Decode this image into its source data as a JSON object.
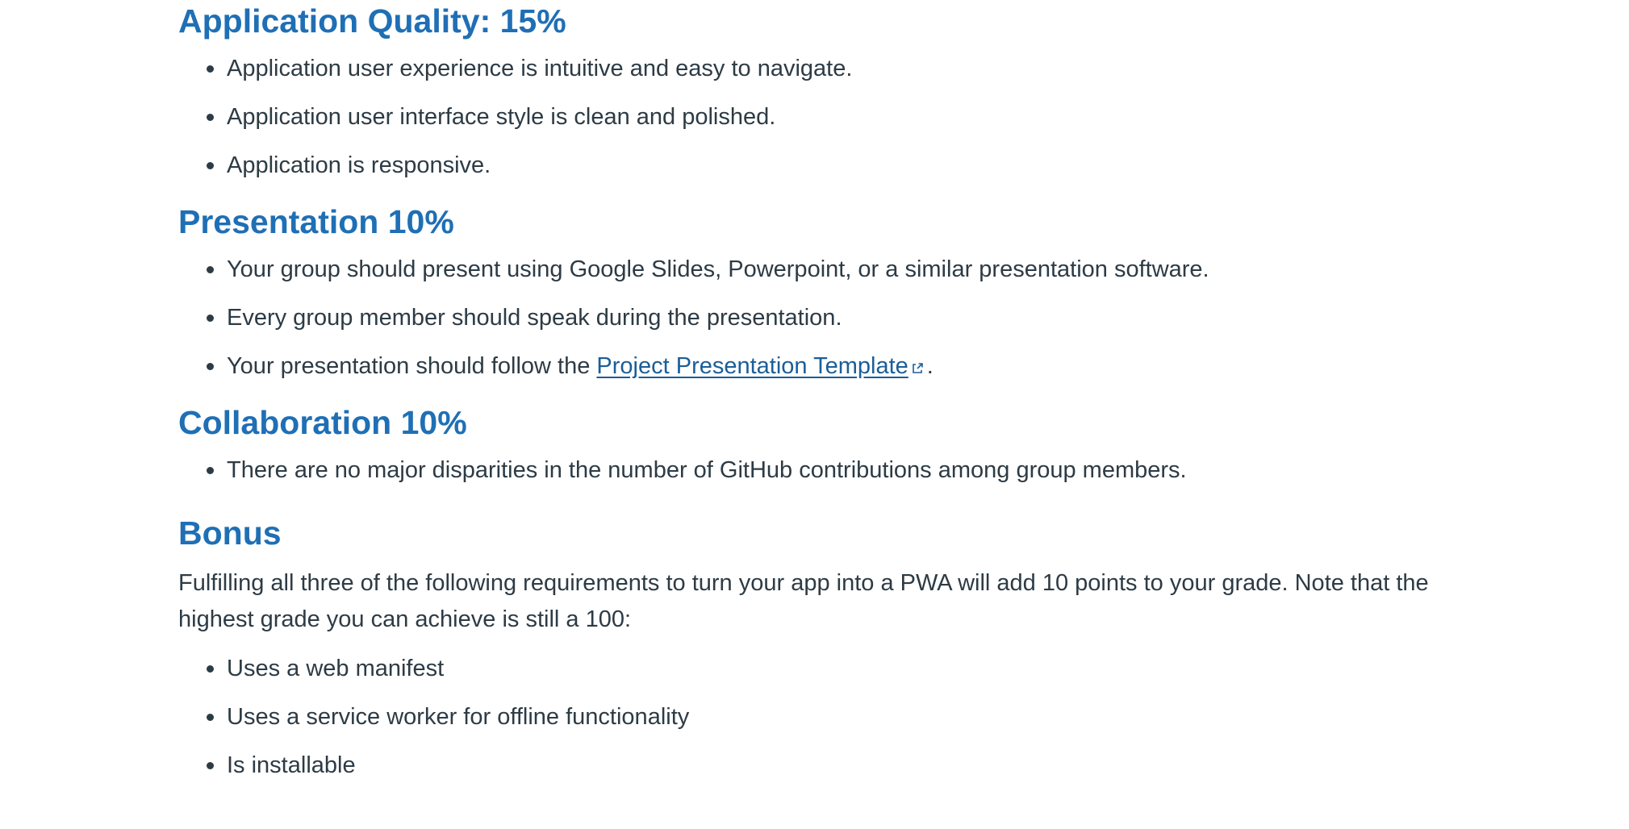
{
  "sections": {
    "quality": {
      "heading": "Application Quality: 15%",
      "items": [
        "Application user experience is intuitive and easy to navigate.",
        "Application user interface style is clean and polished.",
        "Application is responsive."
      ]
    },
    "presentation": {
      "heading": "Presentation 10%",
      "items": [
        "Your group should present using Google Slides, Powerpoint, or a similar presentation software.",
        "Every group member should speak during the presentation."
      ],
      "template_item": {
        "prefix": "Your presentation should follow the ",
        "link_text": "Project Presentation Template",
        "suffix": "."
      }
    },
    "collaboration": {
      "heading": "Collaboration 10%",
      "items": [
        "There are no major disparities in the number of GitHub contributions among group members."
      ]
    },
    "bonus": {
      "heading": "Bonus",
      "paragraph": "Fulfilling all three of the following requirements to turn your app into a PWA will add 10 points to your grade. Note that the highest grade you can achieve is still a 100:",
      "items": [
        "Uses a web manifest",
        "Uses a service worker for offline functionality",
        "Is installable"
      ]
    }
  },
  "colors": {
    "heading": "#1f6fb5",
    "body_text": "#2d3b45",
    "link": "#1b5e98"
  },
  "icons": {
    "external_link": "external-link-icon"
  }
}
